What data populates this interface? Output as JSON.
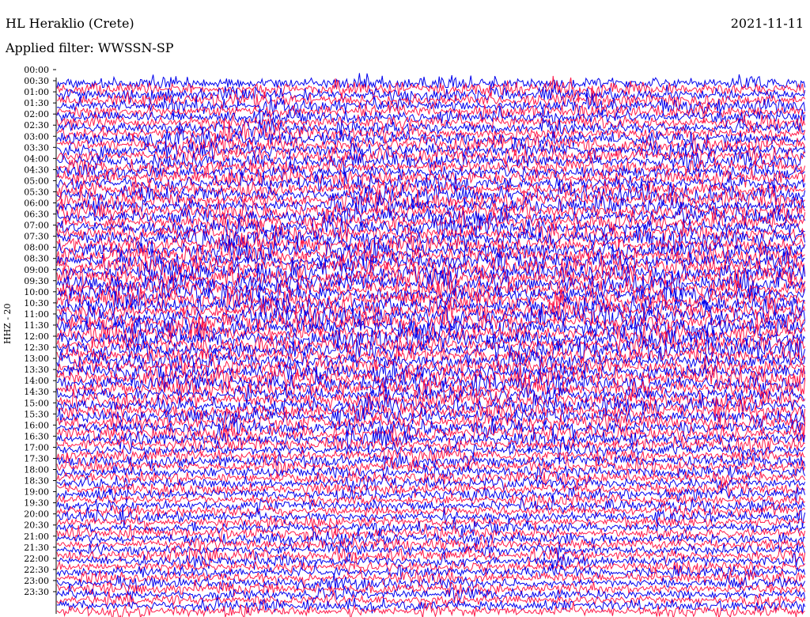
{
  "header": {
    "station": "HL Heraklio (Crete)",
    "date": "2021-11-11",
    "filter": "Applied filter: WWSSN-SP"
  },
  "chart_data": {
    "type": "line",
    "title": "HL Heraklio (Crete)",
    "subtitle": "Applied filter: WWSSN-SP",
    "date": "2021-11-11",
    "ylabel": "HHZ - 20",
    "xlabel": "",
    "trace_colors": [
      "#0000ee",
      "#ff1a4a"
    ],
    "axis_color": "#000000",
    "row_interval_minutes": 15,
    "rows_per_hour": 4,
    "hours": 24,
    "amplitude": "continuous background noise across all 96 traces; no single discrete event",
    "y_tick_labels": [
      "00:00",
      "00:30",
      "01:00",
      "01:30",
      "02:00",
      "02:30",
      "03:00",
      "03:30",
      "04:00",
      "04:30",
      "05:00",
      "05:30",
      "06:00",
      "06:30",
      "07:00",
      "07:30",
      "08:00",
      "08:30",
      "09:00",
      "09:30",
      "10:00",
      "10:30",
      "11:00",
      "11:30",
      "12:00",
      "12:30",
      "13:00",
      "13:30",
      "14:00",
      "14:30",
      "15:00",
      "15:30",
      "16:00",
      "16:30",
      "17:00",
      "17:30",
      "18:00",
      "18:30",
      "19:00",
      "19:30",
      "20:00",
      "20:30",
      "21:00",
      "21:30",
      "22:00",
      "22:30",
      "23:00",
      "23:30"
    ]
  }
}
